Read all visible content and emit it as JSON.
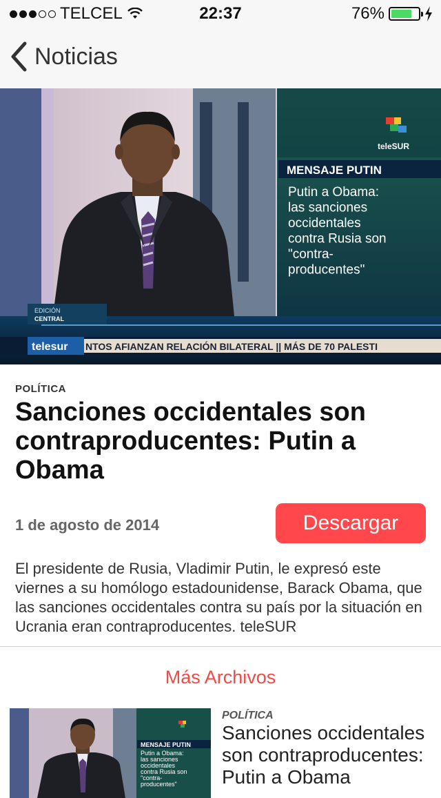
{
  "status_bar": {
    "carrier": "TELCEL",
    "time": "22:37",
    "battery": "76%",
    "battery_level": 0.76,
    "signal_bars": 3,
    "signal_total": 5
  },
  "nav": {
    "back_label": "Noticias"
  },
  "hero": {
    "overlay_heading": "MENSAJE PUTIN",
    "overlay_lines": [
      "Putin a Obama:",
      "las sanciones",
      "occidentales",
      "contra Rusia son",
      "\"contra-",
      "producentes\""
    ],
    "channel_logo": "teleSUR",
    "ticker_logo": "telesur",
    "ticker": "NTOS AFIANZAN RELACIÓN BILATERAL  ||  MÁS DE 70 PALESTI",
    "edition_tag_1": "EDICIÓN",
    "edition_tag_2": "CENTRAL"
  },
  "article": {
    "category": "POLÍTICA",
    "title": "Sanciones occidentales son contraproducentes: Putin a Obama",
    "date": "1 de agosto de 2014",
    "download_label": "Descargar",
    "summary": "El presidente de Rusia, Vladimir Putin, le expresó este viernes a su homólogo estadounidense, Barack Obama, que las sanciones occidentales contra su país por la situación en Ucrania eran contraproducentes. teleSUR"
  },
  "more_label": "Más Archivos",
  "related": [
    {
      "category": "POLÍTICA",
      "title": "Sanciones occidentales son contraproducentes: Putin a Obama",
      "thumb_heading": "MENSAJE PUTIN",
      "thumb_lines": [
        "Putin a Obama:",
        "las sanciones",
        "occidentales",
        "contra Rusia son",
        "\"contra-",
        "producentes\""
      ]
    }
  ],
  "colors": {
    "accent": "#ff474c",
    "more_link": "#f24a45",
    "battery_fill": "#4cd964"
  }
}
